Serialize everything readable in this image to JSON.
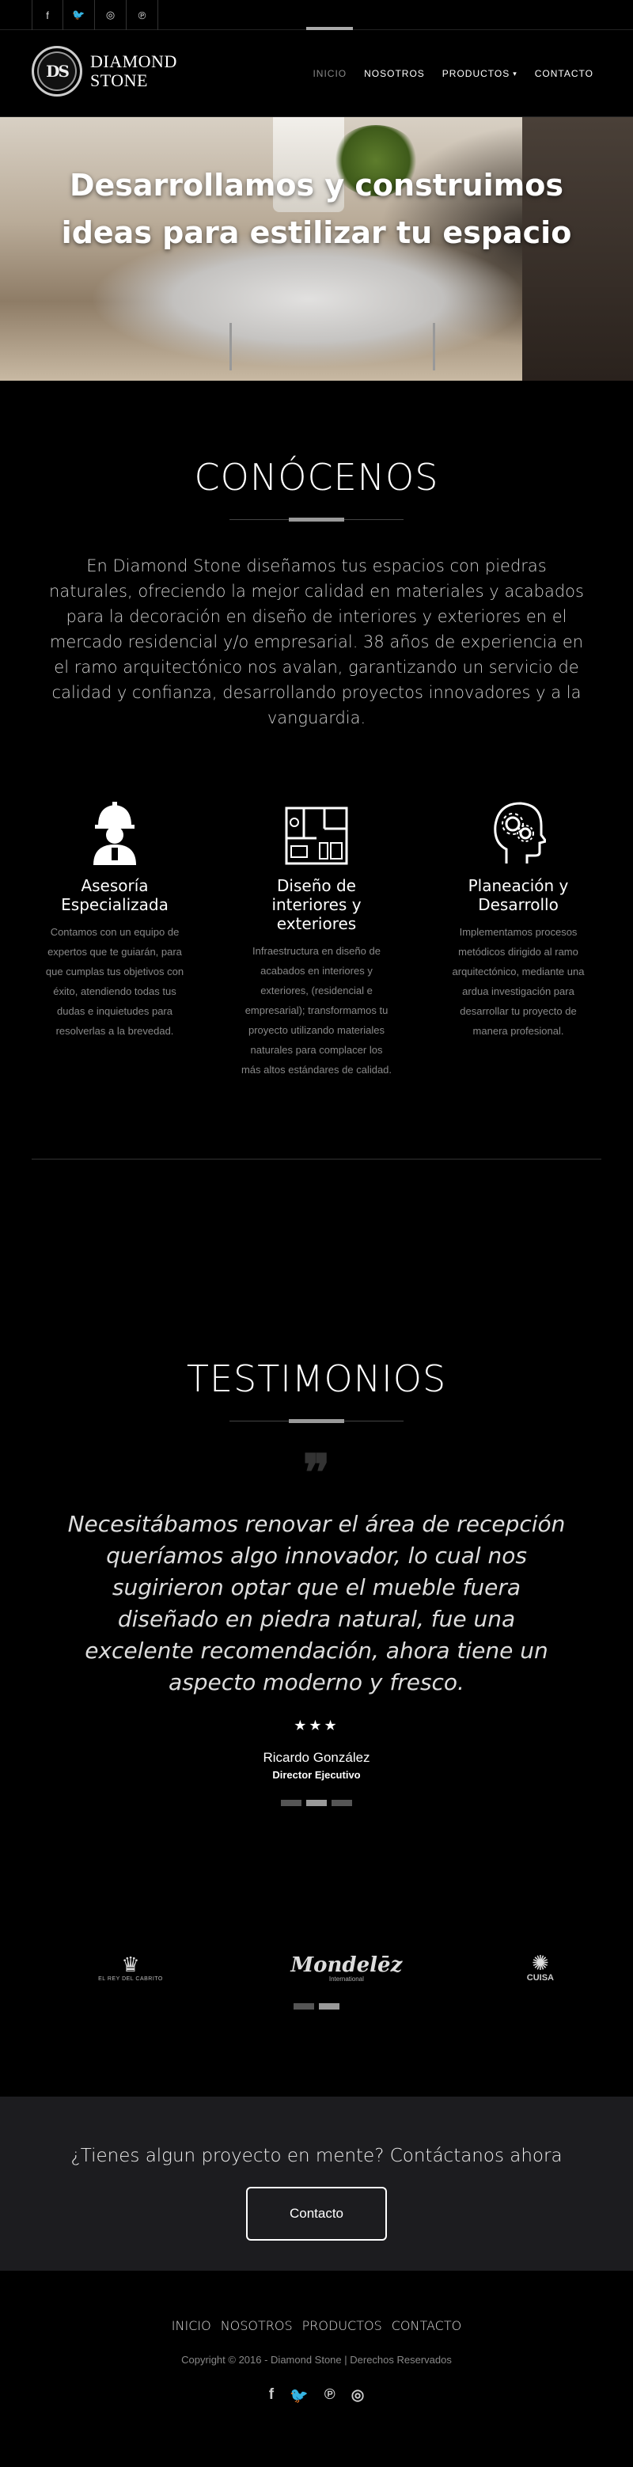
{
  "topbar": {
    "socials": [
      {
        "icon": "facebook-icon",
        "glyph": "f"
      },
      {
        "icon": "twitter-icon",
        "glyph": "🐦"
      },
      {
        "icon": "instagram-icon",
        "glyph": "◎"
      },
      {
        "icon": "pinterest-icon",
        "glyph": "℗"
      }
    ]
  },
  "brand": {
    "monogram": "DS",
    "line1": "DIAMOND",
    "line2": "STONE"
  },
  "nav": {
    "items": [
      {
        "label": "INICIO",
        "active": true
      },
      {
        "label": "NOSOTROS"
      },
      {
        "label": "PRODUCTOS",
        "caret": "▾"
      },
      {
        "label": "CONTACTO"
      }
    ]
  },
  "hero": {
    "line1": "Desarrollamos y construimos",
    "line2": "ideas para estilizar tu espacio"
  },
  "about": {
    "title": "CONÓCENOS",
    "lead": "En Diamond Stone diseñamos tus espacios con piedras naturales, ofreciendo la mejor calidad en materiales y acabados para la decoración en diseño de interiores y exteriores en el mercado residencial y/o empresarial. 38 años de experiencia en el ramo arquitectónico nos avalan, garantizando un servicio de calidad y confianza, desarrollando proyectos innovadores y a la vanguardia.",
    "features": [
      {
        "icon": "worker-helmet-icon",
        "title_l1": "Asesoría",
        "title_l2": "Especializada",
        "title_l3": "",
        "text": "Contamos con un equipo de expertos que te guiarán, para que cumplas tus objetivos con éxito, atendiendo todas tus dudas e inquietudes para resolverlas a la brevedad."
      },
      {
        "icon": "floor-plan-icon",
        "title_l1": "Diseño de",
        "title_l2": "interiores y",
        "title_l3": "exteriores",
        "text": "Infraestructura en diseño de acabados en interiores y exteriores, (residencial e empresarial); transformamos tu proyecto utilizando materiales naturales para complacer los más altos estándares de calidad."
      },
      {
        "icon": "head-gears-icon",
        "title_l1": "Planeación y",
        "title_l2": "Desarrollo",
        "title_l3": "",
        "text": "Implementamos procesos metódicos dirigido al ramo arquitectónico, mediante una ardua investigación para desarrollar tu proyecto de manera profesional."
      }
    ]
  },
  "testimonials": {
    "title": "TESTIMONIOS",
    "quote_mark": "❞",
    "quote": "Necesitábamos renovar el área de recepción queríamos algo innovador, lo cual nos sugirieron optar que el mueble fuera diseñado en piedra natural, fue una excelente recomendación, ahora tiene un aspecto moderno y fresco.",
    "stars": "★★★",
    "rating": 3,
    "author": "Ricardo González",
    "role": "Director Ejecutivo",
    "slides": 3,
    "active_slide": 1
  },
  "clients": {
    "logos": [
      {
        "icon": "crown-logo-icon",
        "mark": "♛",
        "label": "EL REY DEL CABRITO"
      },
      {
        "icon": "mondelez-logo-icon",
        "word": "Mondelēz",
        "sub": "International"
      },
      {
        "icon": "cuisa-logo-icon",
        "mark": "✺",
        "label": "CUISA"
      }
    ],
    "pages": 2,
    "active_page": 1
  },
  "cta": {
    "text": "¿Tienes algun proyecto en mente? Contáctanos ahora",
    "button": "Contacto"
  },
  "footer": {
    "links": [
      "INICIO",
      "NOSOTROS",
      "PRODUCTOS",
      "CONTACTO"
    ],
    "copyright": "Copyright © 2016 - Diamond Stone | Derechos Reservados",
    "socials": [
      {
        "icon": "facebook-icon",
        "glyph": "f"
      },
      {
        "icon": "twitter-icon",
        "glyph": "🐦"
      },
      {
        "icon": "pinterest-icon",
        "glyph": "℗"
      },
      {
        "icon": "instagram-icon",
        "glyph": "◎"
      }
    ]
  }
}
